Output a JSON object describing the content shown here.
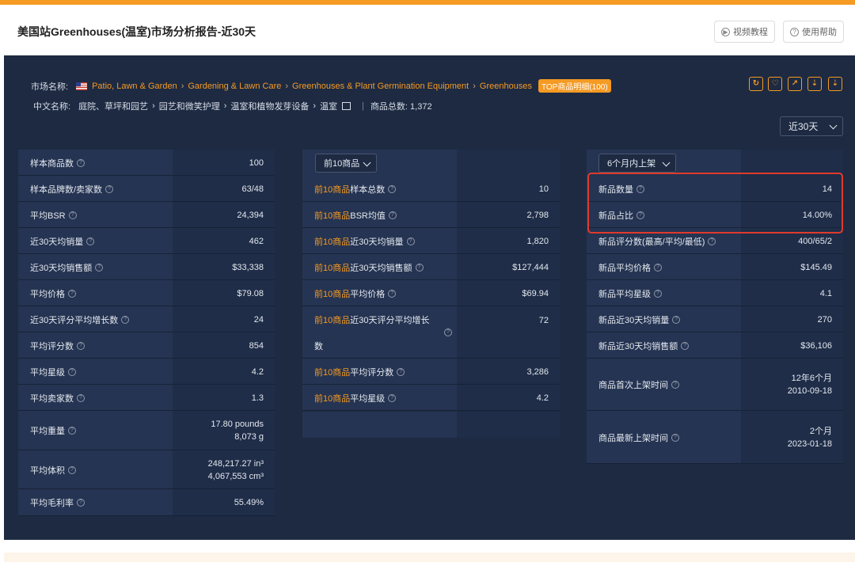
{
  "header": {
    "title": "美国站Greenhouses(温室)市场分析报告-近30天",
    "video_btn": "视频教程",
    "help_btn": "使用帮助"
  },
  "market": {
    "label_name": "市场名称:",
    "crumbs": [
      "Patio, Lawn & Garden",
      "Gardening & Lawn Care",
      "Greenhouses & Plant Germination Equipment",
      "Greenhouses"
    ],
    "badge": "TOP商品明细(100)",
    "label_cn": "中文名称:",
    "crumbs_cn": [
      "庭院、草坪和园艺",
      "园艺和微笑护理",
      "温室和植物发芽设备",
      "温室"
    ],
    "total_label": "商品总数: 1,372"
  },
  "period": "近30天",
  "left_table": [
    {
      "label": "样本商品数",
      "value": "100"
    },
    {
      "label": "样本品牌数/卖家数",
      "value": "63/48"
    },
    {
      "label": "平均BSR",
      "value": "24,394"
    },
    {
      "label": "近30天均销量",
      "value": "462"
    },
    {
      "label": "近30天均销售额",
      "value": "$33,338"
    },
    {
      "label": "平均价格",
      "value": "$79.08"
    },
    {
      "label": "近30天评分平均增长数",
      "value": "24"
    },
    {
      "label": "平均评分数",
      "value": "854"
    },
    {
      "label": "平均星级",
      "value": "4.2"
    },
    {
      "label": "平均卖家数",
      "value": "1.3"
    },
    {
      "label": "平均重量",
      "value": "17.80 pounds",
      "value2": "8,073 g"
    },
    {
      "label": "平均体积",
      "value": "248,217.27 in³",
      "value2": "4,067,553 cm³"
    },
    {
      "label": "平均毛利率",
      "value": "55.49%"
    }
  ],
  "mid_select": "前10商品",
  "mid_table": [
    {
      "prefix": "前10商品",
      "label": "样本总数",
      "value": "10"
    },
    {
      "prefix": "前10商品",
      "label": "BSR均值",
      "value": "2,798"
    },
    {
      "prefix": "前10商品",
      "label": "近30天均销量",
      "value": "1,820"
    },
    {
      "prefix": "前10商品",
      "label": "近30天均销售额",
      "value": "$127,444"
    },
    {
      "prefix": "前10商品",
      "label": "平均价格",
      "value": "$69.94"
    },
    {
      "prefix": "前10商品",
      "label": "近30天评分平均增长",
      "label2": "数",
      "value": "72"
    },
    {
      "prefix": "前10商品",
      "label": "平均评分数",
      "value": "3,286"
    },
    {
      "prefix": "前10商品",
      "label": "平均星级",
      "value": "4.2"
    }
  ],
  "right_select": "6个月内上架",
  "right_table": [
    {
      "label": "新品数量",
      "value": "14"
    },
    {
      "label": "新品占比",
      "value": "14.00%"
    },
    {
      "label": "新品评分数(最高/平均/最低)",
      "value": "400/65/2"
    },
    {
      "label": "新品平均价格",
      "value": "$145.49"
    },
    {
      "label": "新品平均星级",
      "value": "4.1"
    },
    {
      "label": "新品近30天均销量",
      "value": "270"
    },
    {
      "label": "新品近30天均销售额",
      "value": "$36,106"
    },
    {
      "label": "商品首次上架时间",
      "value": "12年6个月",
      "value2": "2010-09-18"
    },
    {
      "label": "商品最新上架时间",
      "value": "2个月",
      "value2": "2023-01-18"
    }
  ],
  "colors": {
    "accent": "#f59a23",
    "panel": "#1d2a42",
    "highlight": "#e03a2c"
  }
}
